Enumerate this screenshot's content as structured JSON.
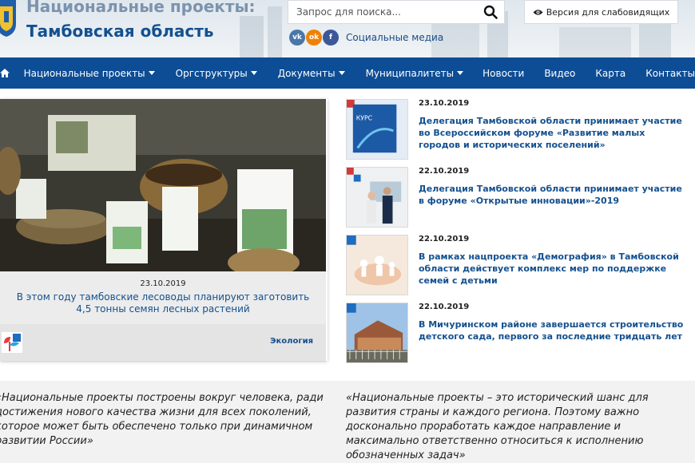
{
  "header": {
    "title_top": "Национальные проекты:",
    "title_main": "Тамбовская область",
    "search_placeholder": "Запрос для поиска...",
    "vision_label": "Версия для слабовидящих",
    "social": {
      "label": "Социальные медиа",
      "icons": [
        "vk-icon",
        "ok-icon",
        "facebook-icon"
      ],
      "colors": [
        "#4a76a8",
        "#ee8208",
        "#3b5998"
      ]
    }
  },
  "nav": {
    "items": [
      {
        "label": "Национальные проекты",
        "dropdown": true
      },
      {
        "label": "Оргструктуры",
        "dropdown": true
      },
      {
        "label": "Документы",
        "dropdown": true
      },
      {
        "label": "Муниципалитеты",
        "dropdown": true
      },
      {
        "label": "Новости",
        "dropdown": false
      },
      {
        "label": "Видео",
        "dropdown": false
      },
      {
        "label": "Карта",
        "dropdown": false
      },
      {
        "label": "Контакты",
        "dropdown": false
      }
    ]
  },
  "feature": {
    "date": "23.10.2019",
    "title": "В этом году тамбовские лесоводы планируют заготовить 4,5 тонны семян лесных растений",
    "category": "Экология"
  },
  "news": [
    {
      "date": "23.10.2019",
      "title": "Делегация Тамбовской области принимает участие во Всероссийском форуме «Развитие малых городов и исторических поселений»"
    },
    {
      "date": "22.10.2019",
      "title": "Делегация Тамбовской области принимает участие в форуме «Открытые инновации»-2019"
    },
    {
      "date": "22.10.2019",
      "title": "В рамках нацпроекта «Демография» в Тамбовской области действует комплекс мер по поддержке семей с детьми"
    },
    {
      "date": "22.10.2019",
      "title": "В Мичуринском районе завершается строительство детского сада, первого за последние тридцать лет"
    }
  ],
  "quotes": {
    "left": "«Национальные проекты построены вокруг человека, ради достижения нового качества жизни для всех поколений, которое может быть обеспечено только при динамичном развитии России»",
    "right": "«Национальные проекты – это исторический шанс для развития страны и каждого региона. Поэтому важно досконально проработать каждое направление и максимально ответственно относиться к исполнению обозначенных задач»"
  },
  "colors": {
    "brand_blue": "#0d4d95",
    "link_blue": "#14508f"
  }
}
